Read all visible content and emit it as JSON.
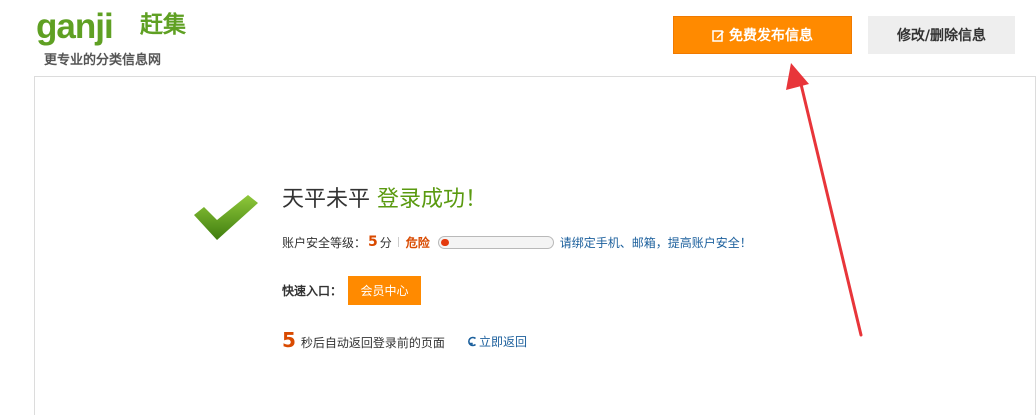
{
  "header": {
    "logo": {
      "latin_text": "ganji",
      "chinese_text": "赶集"
    },
    "tagline": "更专业的分类信息网",
    "post_button_label": "免费发布信息",
    "edit_button_label": "修改/删除信息"
  },
  "main": {
    "username": "天平未平",
    "success_text": "登录成功！",
    "security": {
      "label": "账户安全等级：",
      "score": "5",
      "unit": "分",
      "level": "危险",
      "level_fraction": 0.07,
      "bind_prompt": "请绑定手机、邮箱，提高账户安全！"
    },
    "quick_entry": {
      "label": "快速入口：",
      "member_center_label": "会员中心"
    },
    "redirect": {
      "seconds": "5",
      "text": "秒后自动返回登录前的页面",
      "return_label": "立即返回"
    }
  },
  "colors": {
    "orange": "#ff8a00",
    "green": "#5a9a10",
    "danger": "#d94a00",
    "link": "#1b5f9c",
    "annotation_arrow": "#e8353a"
  },
  "icons": [
    "ganji-logo",
    "edit-icon",
    "check-icon",
    "return-icon",
    "annotation-arrow"
  ]
}
